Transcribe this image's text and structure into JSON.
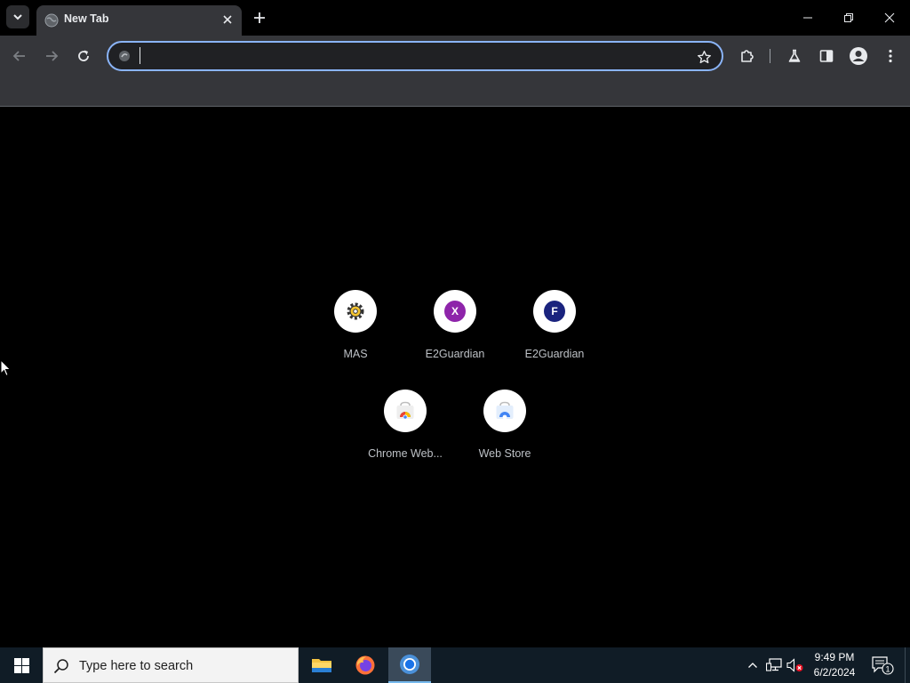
{
  "window": {
    "tab": {
      "title": "New Tab"
    }
  },
  "toolbar": {
    "omnibox": {
      "value": "",
      "placeholder": ""
    }
  },
  "shortcuts": [
    {
      "label": "MAS",
      "icon": "mas-gear-icon"
    },
    {
      "label": "E2Guardian",
      "icon": "letter-badge",
      "letter": "X",
      "color": "#8e24aa"
    },
    {
      "label": "E2Guardian",
      "icon": "letter-badge",
      "letter": "F",
      "color": "#1a237e"
    },
    {
      "label": "Chrome Web...",
      "icon": "chrome-web-store-icon"
    },
    {
      "label": "Web Store",
      "icon": "web-store-icon"
    }
  ],
  "taskbar": {
    "search_placeholder": "Type here to search",
    "apps": [
      "file-explorer-icon",
      "firefox-icon",
      "chrome-icon"
    ],
    "clock": {
      "time": "9:49 PM",
      "date": "6/2/2024"
    },
    "notification_count": "1"
  },
  "colors": {
    "omnibox_focus": "#8ab4f8",
    "toolbar_bg": "#35363a",
    "page_bg": "#000000",
    "taskbar_bg": "#101c26"
  }
}
